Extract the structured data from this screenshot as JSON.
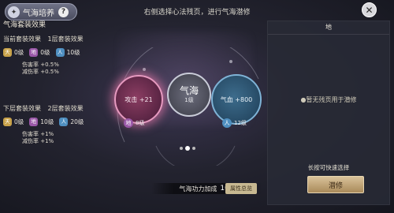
{
  "header": {
    "title": "气海培养",
    "emblem_char": "✦",
    "help_label": "?",
    "instruction": "右侧选择心法残页，进行气海潜修",
    "close_glyph": "✕"
  },
  "left_panel": {
    "section_title": "气海套装效果",
    "current": {
      "label": "当前套装效果",
      "level_label": "1层套装效果",
      "badges": [
        {
          "char": "天",
          "value": "0级",
          "color": "#c8a24a"
        },
        {
          "char": "地",
          "value": "0级",
          "color": "#9a58a8"
        },
        {
          "char": "人",
          "value": "10级",
          "color": "#4f8fc0"
        }
      ],
      "stats": [
        "伤害率 +0.5%",
        "减伤率 +0.5%"
      ]
    },
    "next": {
      "label": "下层套装效果",
      "level_label": "2层套装效果",
      "badges": [
        {
          "char": "天",
          "value": "0级",
          "color": "#c8a24a"
        },
        {
          "char": "地",
          "value": "10级",
          "color": "#9a58a8"
        },
        {
          "char": "人",
          "value": "20级",
          "color": "#4f8fc0"
        }
      ],
      "stats": [
        "伤害率 +1%",
        "减伤率 +1%"
      ]
    }
  },
  "center": {
    "left_orb": {
      "text": "攻击 +21",
      "badge_char": "地",
      "level": "8级",
      "badge_color": "#9a58a8"
    },
    "center_orb": {
      "title": "气海",
      "level": "1级"
    },
    "right_orb": {
      "text": "气血 +800",
      "badge_char": "人",
      "level": "12级",
      "badge_color": "#4f8fc0"
    },
    "pagination": {
      "count": 3,
      "active": 1
    }
  },
  "bottom": {
    "label": "气海功力加成",
    "value": "106",
    "button_label": "属性总览"
  },
  "right_panel": {
    "header": "地",
    "empty_text": "●暂无残页用于潜修",
    "hint": "长按可快速选择",
    "button_label": "潜修"
  }
}
